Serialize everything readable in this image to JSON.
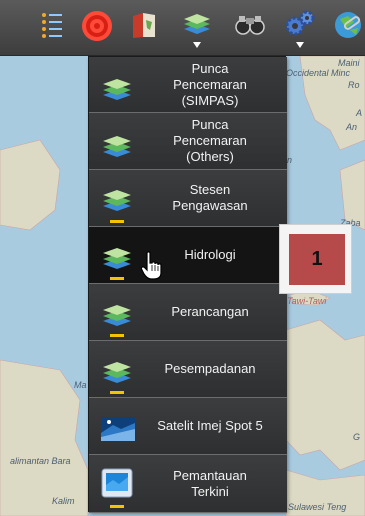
{
  "toolbar": {
    "buttons": [
      {
        "icon": "layer-list-icon"
      },
      {
        "icon": "target-icon"
      },
      {
        "icon": "map-book-icon"
      },
      {
        "icon": "layers-icon",
        "has_dropdown": true
      },
      {
        "icon": "binoculars-icon"
      },
      {
        "icon": "settings-gears-icon",
        "has_dropdown": true
      },
      {
        "icon": "globe-link-icon"
      }
    ]
  },
  "map_labels": {
    "top_right_1": "Maini",
    "top_right_2": "Occidental Minc",
    "top_right_3": "Ro",
    "right_1": "A",
    "right_2": "An",
    "right_3": "n",
    "right_4": "Zaba",
    "tawi": "Tawi-Tawi",
    "left_ma": "Ma",
    "kalimantan": "alimantan Bara",
    "kalim": "Kalim",
    "right_g": "G",
    "sulawesi": "Sulawesi Teng"
  },
  "menu": {
    "items": [
      {
        "label_lines": [
          "Punca",
          "Pencemaran",
          "(SIMPAS)"
        ],
        "icon": "layers-icon",
        "indicator": false,
        "active": false
      },
      {
        "label_lines": [
          "Punca",
          "Pencemaran",
          "(Others)"
        ],
        "icon": "layers-icon",
        "indicator": false,
        "active": false
      },
      {
        "label_lines": [
          "Stesen",
          "Pengawasan"
        ],
        "icon": "layers-icon",
        "indicator": true,
        "active": false
      },
      {
        "label_lines": [
          "Hidrologi"
        ],
        "icon": "layers-icon",
        "indicator": true,
        "active": true
      },
      {
        "label_lines": [
          "Perancangan"
        ],
        "icon": "layers-icon",
        "indicator": true,
        "active": false
      },
      {
        "label_lines": [
          "Pesempadanan"
        ],
        "icon": "layers-icon",
        "indicator": true,
        "active": false
      },
      {
        "label_lines": [
          "Satelit Imej Spot 5"
        ],
        "icon": "satellite-image-icon",
        "indicator": false,
        "active": false
      },
      {
        "label_lines": [
          "Pemantauan",
          "Terkini"
        ],
        "icon": "monitor-icon",
        "indicator": true,
        "active": false
      }
    ]
  },
  "callout": {
    "number": "1"
  },
  "colors": {
    "toolbar_bg": "#4a4a4a",
    "menu_bg": "#2f3133",
    "active_bg": "#141414",
    "indicator": "#f4c400",
    "callout_red": "#b64a4a",
    "water": "#a9cbe0",
    "land": "#dcd9c4"
  }
}
